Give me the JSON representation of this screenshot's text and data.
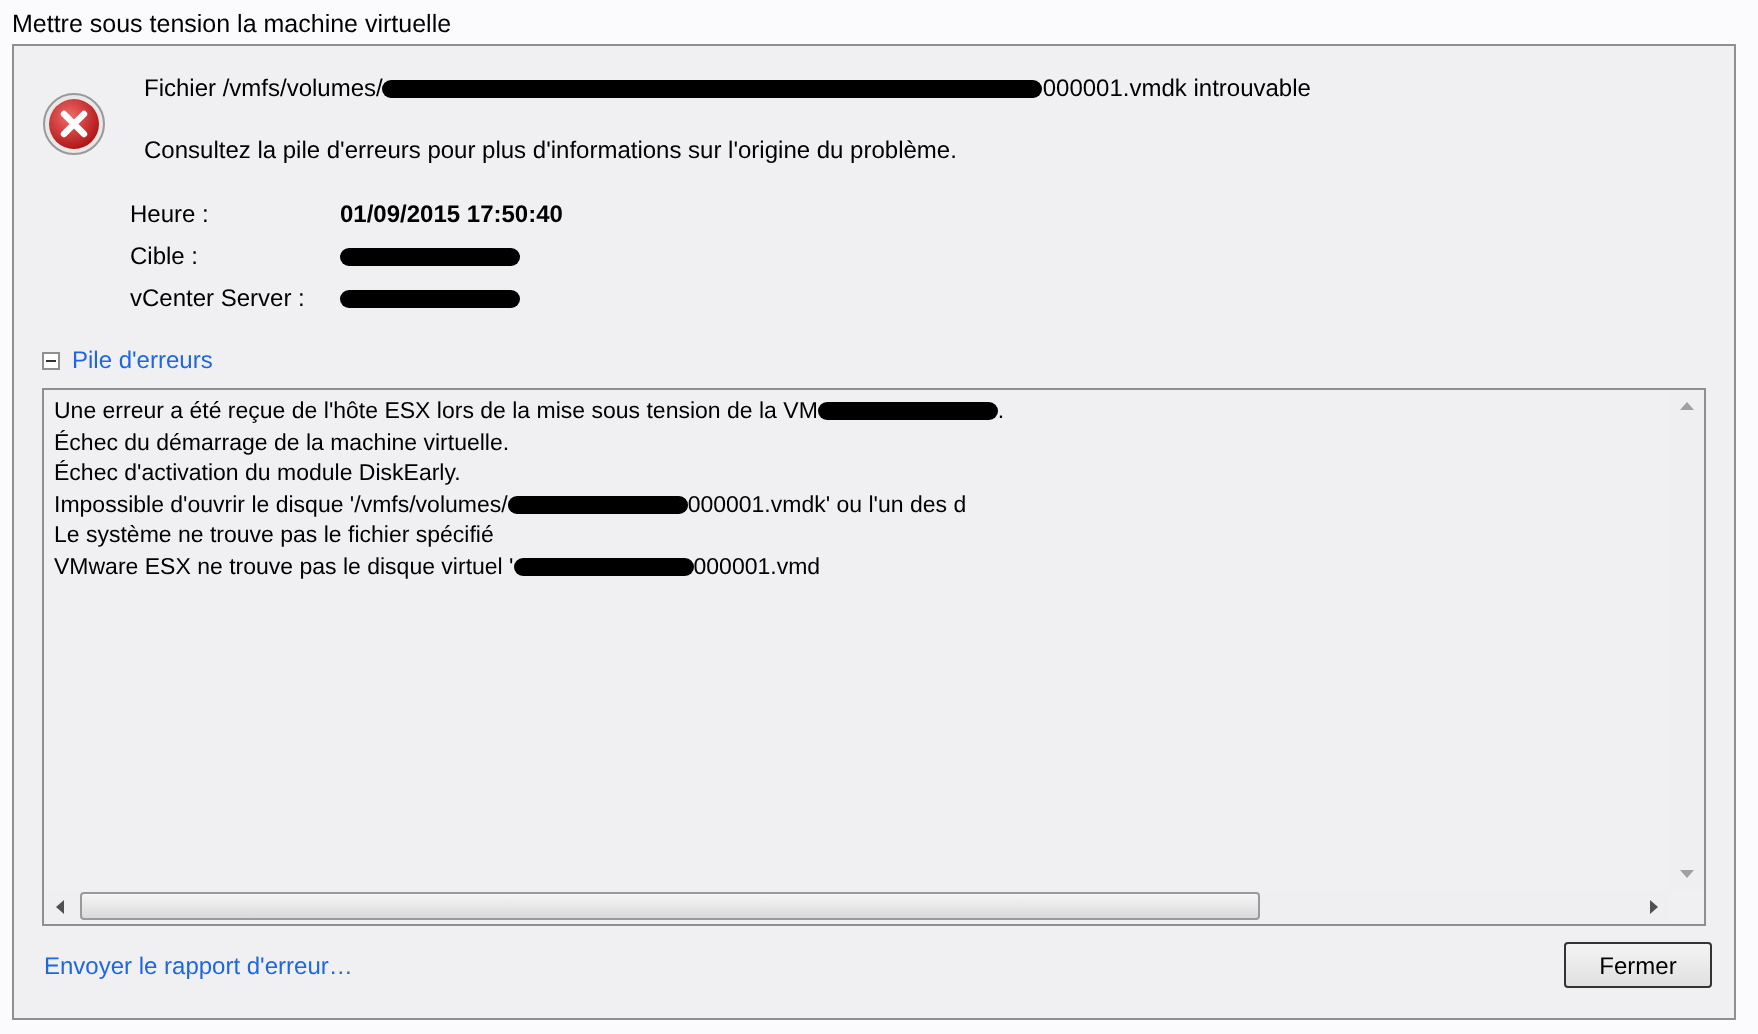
{
  "window": {
    "title": "Mettre sous tension la machine virtuelle"
  },
  "message": {
    "segments": [
      {
        "kind": "text",
        "text": "Fichier /vmfs/volumes/"
      },
      {
        "kind": "redacted"
      },
      {
        "kind": "text",
        "text": "000001.vmdk introuvable"
      }
    ]
  },
  "hint": "Consultez la pile d'erreurs pour plus d'informations sur l'origine du problème.",
  "details": [
    {
      "label": "Heure :",
      "segments": [
        {
          "kind": "text",
          "text": "01/09/2015 17:50:40"
        }
      ]
    },
    {
      "label": "Cible :",
      "segments": [
        {
          "kind": "redacted"
        }
      ]
    },
    {
      "label": "vCenter Server :",
      "segments": [
        {
          "kind": "redacted"
        }
      ]
    }
  ],
  "stack": {
    "label": "Pile d'erreurs",
    "expanded": true,
    "lines": [
      {
        "segments": [
          {
            "kind": "text",
            "text": "Une erreur a été reçue de l'hôte ESX lors de la mise sous tension de la VM"
          },
          {
            "kind": "redacted"
          },
          {
            "kind": "text",
            "text": "."
          }
        ]
      },
      {
        "segments": [
          {
            "kind": "text",
            "text": "Échec du démarrage de la machine virtuelle."
          }
        ]
      },
      {
        "segments": [
          {
            "kind": "text",
            "text": "Échec d'activation du module DiskEarly."
          }
        ]
      },
      {
        "segments": [
          {
            "kind": "text",
            "text": "Impossible d'ouvrir le disque '/vmfs/volumes/"
          },
          {
            "kind": "redacted"
          },
          {
            "kind": "text",
            "text": "000001.vmdk' ou l'un des d"
          }
        ]
      },
      {
        "segments": [
          {
            "kind": "text",
            "text": "Le système ne trouve pas le fichier spécifié"
          }
        ]
      },
      {
        "segments": [
          {
            "kind": "text",
            "text": "VMware ESX ne trouve pas le disque virtuel '"
          },
          {
            "kind": "redacted"
          },
          {
            "kind": "text",
            "text": "000001.vmd"
          }
        ]
      }
    ]
  },
  "report_link": "Envoyer le rapport d'erreur…",
  "buttons": [
    "Fermer"
  ]
}
